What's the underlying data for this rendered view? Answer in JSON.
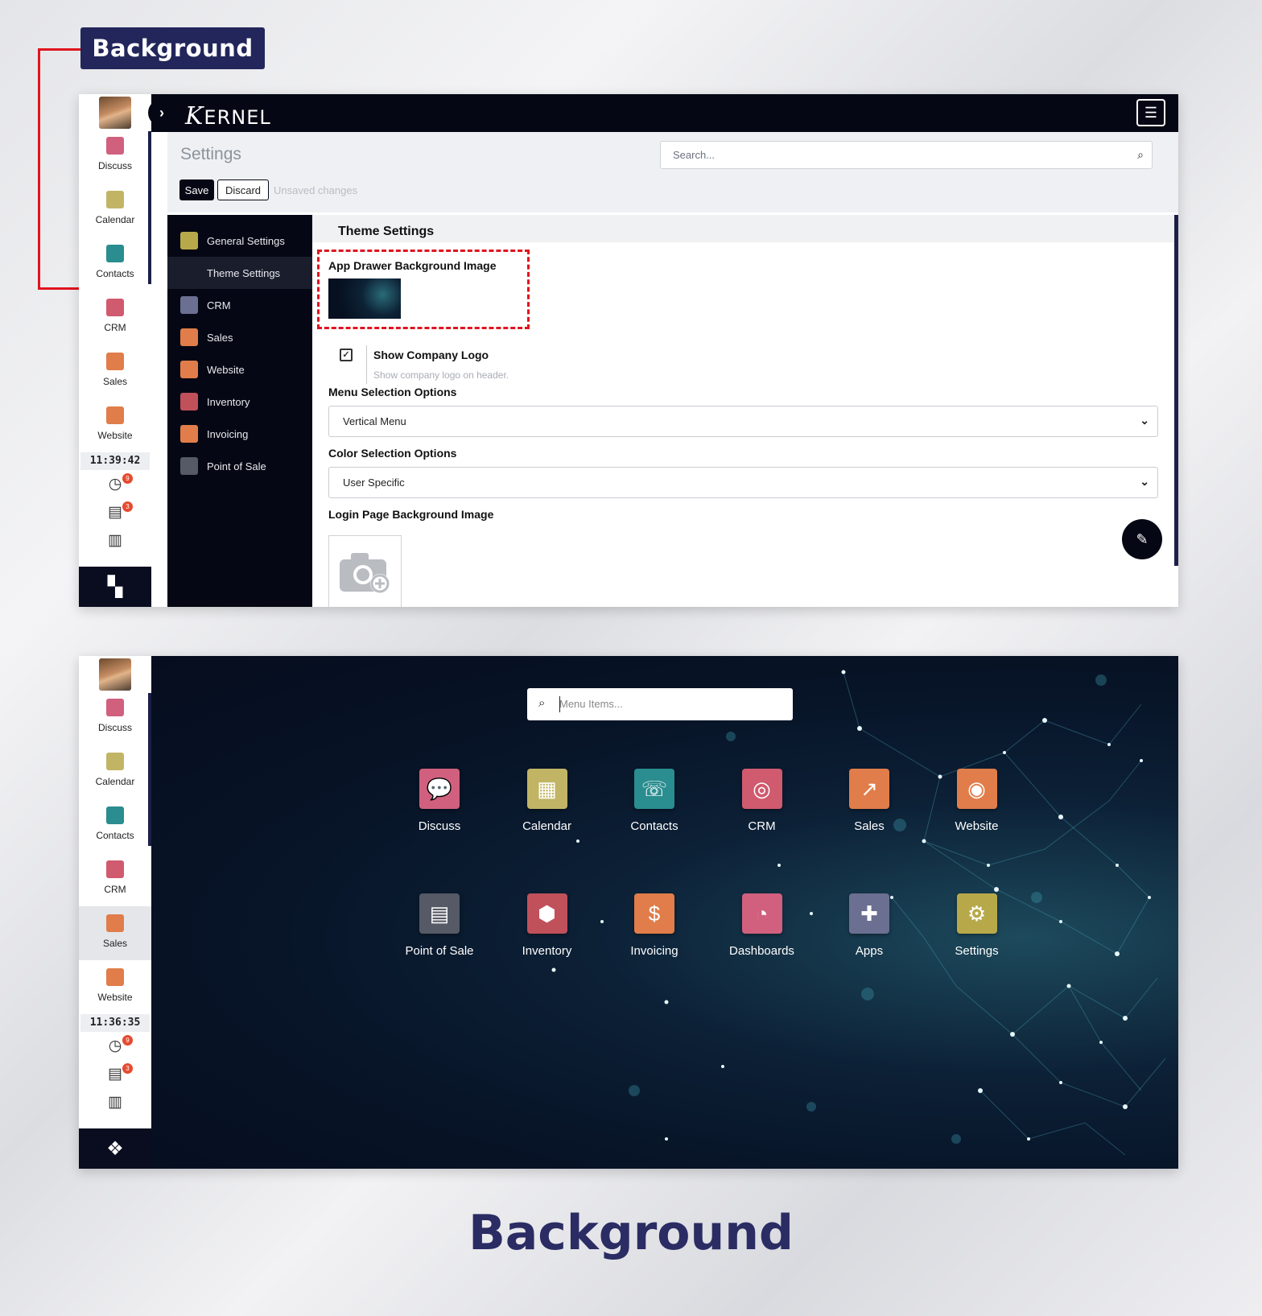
{
  "callout": {
    "label": "Background"
  },
  "footer_title": "Background",
  "sidebar_top": {
    "items": [
      {
        "label": "Discuss",
        "icon": "discuss-icon",
        "color": "#d0607e"
      },
      {
        "label": "Calendar",
        "icon": "calendar-icon",
        "color": "#c1b565"
      },
      {
        "label": "Contacts",
        "icon": "contacts-icon",
        "color": "#2a8d8f"
      },
      {
        "label": "CRM",
        "icon": "crm-icon",
        "color": "#d05a6e"
      },
      {
        "label": "Sales",
        "icon": "sales-icon",
        "color": "#e07d4a"
      },
      {
        "label": "Website",
        "icon": "website-icon",
        "color": "#e07d4a"
      }
    ],
    "clock": "11:39:42",
    "activity_badge": "9",
    "message_badge": "3"
  },
  "sidebar_bottom": {
    "items": [
      {
        "label": "Discuss",
        "icon": "discuss-icon",
        "color": "#d0607e"
      },
      {
        "label": "Calendar",
        "icon": "calendar-icon",
        "color": "#c1b565"
      },
      {
        "label": "Contacts",
        "icon": "contacts-icon",
        "color": "#2a8d8f"
      },
      {
        "label": "CRM",
        "icon": "crm-icon",
        "color": "#d05a6e"
      },
      {
        "label": "Sales",
        "icon": "sales-icon",
        "color": "#e07d4a"
      },
      {
        "label": "Website",
        "icon": "website-icon",
        "color": "#e07d4a"
      }
    ],
    "clock": "11:36:35",
    "activity_badge": "9",
    "message_badge": "3"
  },
  "topbar": {
    "logo_text": "ERNEL",
    "logo_mark": "K"
  },
  "control_panel": {
    "title": "Settings",
    "search_placeholder": "Search...",
    "save_label": "Save",
    "discard_label": "Discard",
    "unsaved_label": "Unsaved changes"
  },
  "settings_nav": [
    {
      "label": "General Settings",
      "icon": "gear-icon",
      "color": "#b7a94a"
    },
    {
      "label": "Theme Settings",
      "icon": "theme-icon",
      "color": "#1a1d2c"
    },
    {
      "label": "CRM",
      "icon": "handshake-icon",
      "color": "#6b6f91"
    },
    {
      "label": "Sales",
      "icon": "sales-icon",
      "color": "#e07d4a"
    },
    {
      "label": "Website",
      "icon": "website-icon",
      "color": "#e07d4a"
    },
    {
      "label": "Inventory",
      "icon": "inventory-icon",
      "color": "#c0505a"
    },
    {
      "label": "Invoicing",
      "icon": "invoicing-icon",
      "color": "#e07d4a"
    },
    {
      "label": "Point of Sale",
      "icon": "pos-icon",
      "color": "#555a66"
    }
  ],
  "theme_settings": {
    "section_title": "Theme Settings",
    "app_drawer_bg_label": "App Drawer Background Image",
    "show_logo_label": "Show Company Logo",
    "show_logo_desc": "Show company logo on header.",
    "show_logo_checked": true,
    "menu_selection_label": "Menu Selection Options",
    "menu_selection_value": "Vertical Menu",
    "color_selection_label": "Color Selection Options",
    "color_selection_value": "User Specific",
    "login_bg_label": "Login Page Background Image"
  },
  "app_drawer": {
    "search_placeholder": "Menu Items...",
    "apps": [
      {
        "label": "Discuss",
        "icon": "discuss-icon",
        "color": "#d0607e",
        "glyph": "💬"
      },
      {
        "label": "Calendar",
        "icon": "calendar-icon",
        "color": "#c1b565",
        "glyph": "▦"
      },
      {
        "label": "Contacts",
        "icon": "contacts-icon",
        "color": "#2a8d8f",
        "glyph": "☏"
      },
      {
        "label": "CRM",
        "icon": "crm-icon",
        "color": "#d05a6e",
        "glyph": "◎"
      },
      {
        "label": "Sales",
        "icon": "sales-icon",
        "color": "#e07d4a",
        "glyph": "↗"
      },
      {
        "label": "Website",
        "icon": "website-icon",
        "color": "#e07d4a",
        "glyph": "◉"
      },
      {
        "label": "Point of Sale",
        "icon": "pos-icon",
        "color": "#555a66",
        "glyph": "▤"
      },
      {
        "label": "Inventory",
        "icon": "inventory-icon",
        "color": "#c0505a",
        "glyph": "⬢"
      },
      {
        "label": "Invoicing",
        "icon": "invoicing-icon",
        "color": "#e07d4a",
        "glyph": "$"
      },
      {
        "label": "Dashboards",
        "icon": "dashboards-icon",
        "color": "#d0607e",
        "glyph": "◔"
      },
      {
        "label": "Apps",
        "icon": "apps-puzzle-icon",
        "color": "#6b6f91",
        "glyph": "✚"
      },
      {
        "label": "Settings",
        "icon": "settings-gear-icon",
        "color": "#b7a94a",
        "glyph": "⚙"
      }
    ]
  }
}
